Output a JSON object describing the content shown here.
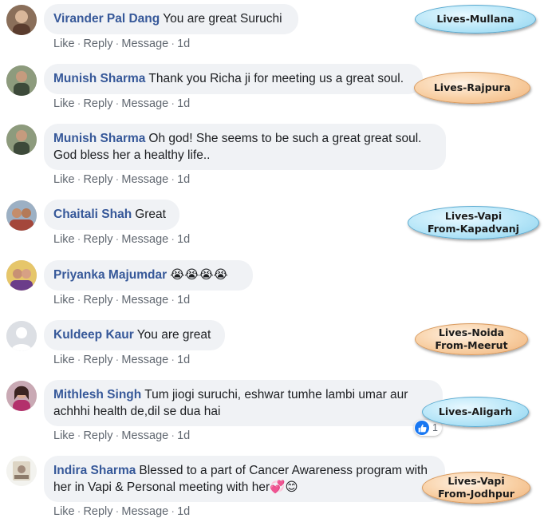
{
  "actions": {
    "like": "Like",
    "reply": "Reply",
    "message": "Message",
    "time": "1d",
    "sep": "·"
  },
  "comments": [
    {
      "author": "Virander Pal Dang",
      "text": "You are great Suruchi"
    },
    {
      "author": "Munish Sharma",
      "text": "Thank you Richa ji for meeting us a great soul."
    },
    {
      "author": "Munish Sharma",
      "text": "Oh god! She seems to be such a great great soul. God bless her a healthy life.."
    },
    {
      "author": "Chaitali Shah",
      "text": "Great"
    },
    {
      "author": "Priyanka Majumdar",
      "text": "😭😭😭😭"
    },
    {
      "author": "Kuldeep Kaur",
      "text": "You are great"
    },
    {
      "author": "Mithlesh Singh",
      "text": "Tum jiogi suruchi, eshwar tumhe lambi umar aur achhhi health de,dil se dua hai",
      "reaction_count": "1"
    },
    {
      "author": "Indira Sharma",
      "text": "Blessed to a part of Cancer Awareness program with her in Vapi & Personal meeting with her💞😊"
    }
  ],
  "tags": [
    {
      "lines": [
        "Lives-Mullana"
      ],
      "style": "blue"
    },
    {
      "lines": [
        "Lives-Rajpura"
      ],
      "style": "orange"
    },
    {
      "lines": [
        "Lives-Vapi",
        "From-Kapadvanj"
      ],
      "style": "blue"
    },
    {
      "lines": [
        "Lives-Noida",
        "From-Meerut"
      ],
      "style": "orange"
    },
    {
      "lines": [
        "Lives-Aligarh"
      ],
      "style": "blue"
    },
    {
      "lines": [
        "Lives-Vapi",
        "From-Jodhpur"
      ],
      "style": "orange"
    }
  ],
  "colors": {
    "author": "#365899",
    "bubble": "#f0f2f5",
    "action": "#606770",
    "like_blue": "#1877f2"
  },
  "icons": {
    "reaction": "thumbs-up-icon",
    "avatar_placeholder": "default-user-icon"
  }
}
